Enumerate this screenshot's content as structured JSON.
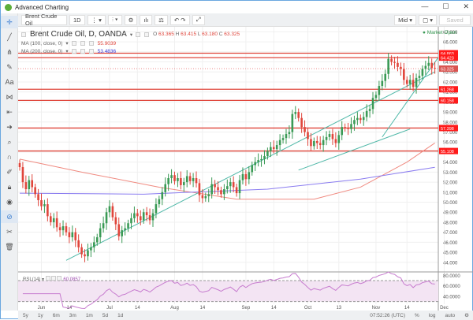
{
  "window": {
    "title": "Advanced Charting",
    "min": "—",
    "max": "☐",
    "close": "✕"
  },
  "toolbar": {
    "symbol": "Brent Crude Oil",
    "interval": "1D",
    "layout": "Mid",
    "saved": "Saved"
  },
  "legend": {
    "title": "Brent Crude Oil, D, OANDA",
    "open_label": "O",
    "open": "63.365",
    "high_label": "H",
    "high": "63.415",
    "low_label": "L",
    "low": "63.180",
    "close_label": "C",
    "close": "63.325",
    "ma100": "MA (100, close, 0)",
    "ma100_val": "55.9039",
    "ma200": "MA (200, close, 0)",
    "ma200_val": "53.4836",
    "rsi": "RSI (14)",
    "rsi_val": "60.0857"
  },
  "status": "Market Open",
  "bottom": {
    "ranges": [
      "5y",
      "1y",
      "6m",
      "3m",
      "1m",
      "5d",
      "1d"
    ],
    "time": "07:52:26 (UTC)",
    "pct": "%",
    "log": "log",
    "auto": "auto"
  },
  "colors": {
    "up": "#3a9a55",
    "down": "#e0463c",
    "ma100": "#f08a80",
    "ma200": "#8a7cf0",
    "trend": "#4fb8a8",
    "level": "#e0463c",
    "rsi": "#c77ccf"
  },
  "chart_data": {
    "type": "candlestick",
    "title": "Brent Crude Oil, D, OANDA",
    "closes": [
      53.5,
      52.0,
      51.3,
      52.2,
      51.5,
      50.8,
      50.2,
      49.6,
      49.8,
      48.6,
      48.0,
      48.4,
      47.5,
      47.2,
      47.6,
      47.0,
      46.5,
      47.0,
      46.2,
      45.5,
      44.8,
      44.6,
      45.2,
      45.5,
      46.0,
      46.5,
      47.4,
      47.9,
      49.0,
      49.6,
      48.5,
      47.8,
      46.6,
      47.2,
      47.4,
      47.9,
      48.4,
      48.9,
      48.6,
      48.2,
      49.0,
      48.7,
      48.2,
      48.9,
      49.8,
      50.3,
      51.0,
      51.8,
      52.4,
      52.7,
      52.1,
      52.4,
      51.7,
      52.0,
      52.6,
      52.1,
      52.4,
      51.9,
      50.7,
      50.4,
      50.6,
      50.8,
      51.8,
      51.5,
      51.2,
      50.8,
      51.3,
      51.6,
      52.0,
      51.5,
      50.9,
      52.2,
      52.8,
      52.3,
      53.0,
      53.7,
      54.0,
      54.2,
      54.3,
      54.6,
      55.1,
      55.5,
      55.3,
      55.7,
      56.2,
      56.4,
      56.8,
      57.0,
      58.8,
      59.0,
      58.4,
      57.5,
      57.0,
      56.3,
      55.6,
      56.1,
      55.9,
      55.7,
      56.2,
      56.5,
      56.8,
      56.3,
      55.9,
      56.7,
      57.5,
      57.4,
      57.3,
      57.8,
      58.2,
      58.4,
      58.2,
      58.5,
      59.1,
      59.3,
      60.4,
      60.7,
      61.6,
      62.1,
      62.8,
      64.3,
      64.0,
      63.9,
      63.5,
      63.3,
      62.2,
      61.8,
      62.2,
      61.5,
      62.4,
      62.6,
      63.3,
      63.6,
      63.9,
      63.4,
      63.325
    ],
    "ma100": [
      [
        0,
        54.3
      ],
      [
        20,
        53.0
      ],
      [
        45,
        51.5
      ],
      [
        70,
        50.3
      ],
      [
        95,
        50.3
      ],
      [
        110,
        51.5
      ],
      [
        125,
        54.0
      ],
      [
        134,
        55.9039
      ]
    ],
    "ma200": [
      [
        0,
        50.9
      ],
      [
        40,
        50.8
      ],
      [
        80,
        51.3
      ],
      [
        110,
        52.3
      ],
      [
        134,
        53.4836
      ]
    ],
    "levels": [
      64.863,
      64.423,
      61.268,
      60.158,
      57.398,
      55.108
    ],
    "current": 63.325,
    "trendlines": [
      [
        [
          15,
          44.2
        ],
        [
          134,
          63.0
        ]
      ],
      [
        [
          90,
          53.2
        ],
        [
          126,
          57.3
        ]
      ],
      [
        [
          117,
          56.5
        ],
        [
          135,
          64.4
        ]
      ]
    ],
    "y_ticks": [
      44,
      45,
      46,
      47,
      48,
      49,
      50,
      51,
      52,
      53,
      54,
      55,
      56,
      57,
      58,
      59,
      60,
      61,
      62,
      63,
      64,
      65,
      66,
      67
    ],
    "ylim": [
      43.2,
      67.5
    ],
    "x_ticks": [
      {
        "i": 7,
        "label": "Jun"
      },
      {
        "i": 16,
        "label": "14"
      },
      {
        "i": 29,
        "label": "Jul"
      },
      {
        "i": 38,
        "label": "14"
      },
      {
        "i": 50,
        "label": "Aug"
      },
      {
        "i": 59,
        "label": "14"
      },
      {
        "i": 73,
        "label": "Sep"
      },
      {
        "i": 82,
        "label": "14"
      },
      {
        "i": 93,
        "label": "Oct"
      },
      {
        "i": 103,
        "label": "13"
      },
      {
        "i": 115,
        "label": "Nov"
      },
      {
        "i": 125,
        "label": "14"
      },
      {
        "i": 137,
        "label": "Dec"
      }
    ],
    "rsi_ticks": [
      80,
      60,
      40
    ]
  }
}
